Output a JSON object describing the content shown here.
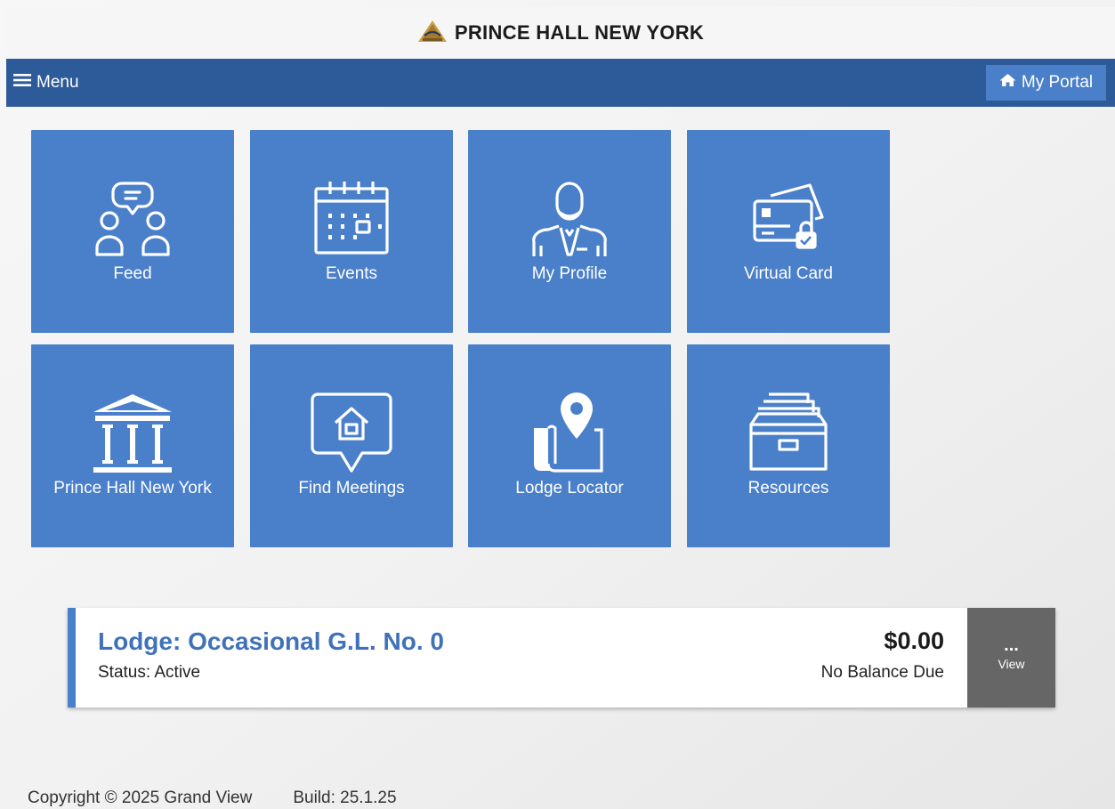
{
  "header": {
    "title": "PRINCE HALL NEW YORK",
    "logo_icon": "pyramid-logo-icon"
  },
  "navbar": {
    "menu_label": "Menu",
    "portal_label": "My Portal"
  },
  "tiles": [
    {
      "label": "Feed",
      "icon": "chat-people-icon"
    },
    {
      "label": "Events",
      "icon": "calendar-icon"
    },
    {
      "label": "My Profile",
      "icon": "profile-icon"
    },
    {
      "label": "Virtual Card",
      "icon": "credit-card-lock-icon"
    },
    {
      "label": "Prince Hall New York",
      "icon": "building-columns-icon"
    },
    {
      "label": "Find Meetings",
      "icon": "home-speech-icon"
    },
    {
      "label": "Lodge Locator",
      "icon": "map-pin-icon"
    },
    {
      "label": "Resources",
      "icon": "file-cabinet-icon"
    }
  ],
  "lodge": {
    "title": "Lodge: Occasional G.L. No. 0",
    "status": "Status: Active",
    "amount": "$0.00",
    "balance_text": "No Balance Due",
    "view_dots": "...",
    "view_label": "View"
  },
  "footer": {
    "copyright": "Copyright © 2025 Grand View",
    "build": "Build: 25.1.25"
  },
  "colors": {
    "navbar": "#2d5b9a",
    "tile": "#4a7fca",
    "view_button": "#666666",
    "lodge_title": "#3f72b8"
  }
}
